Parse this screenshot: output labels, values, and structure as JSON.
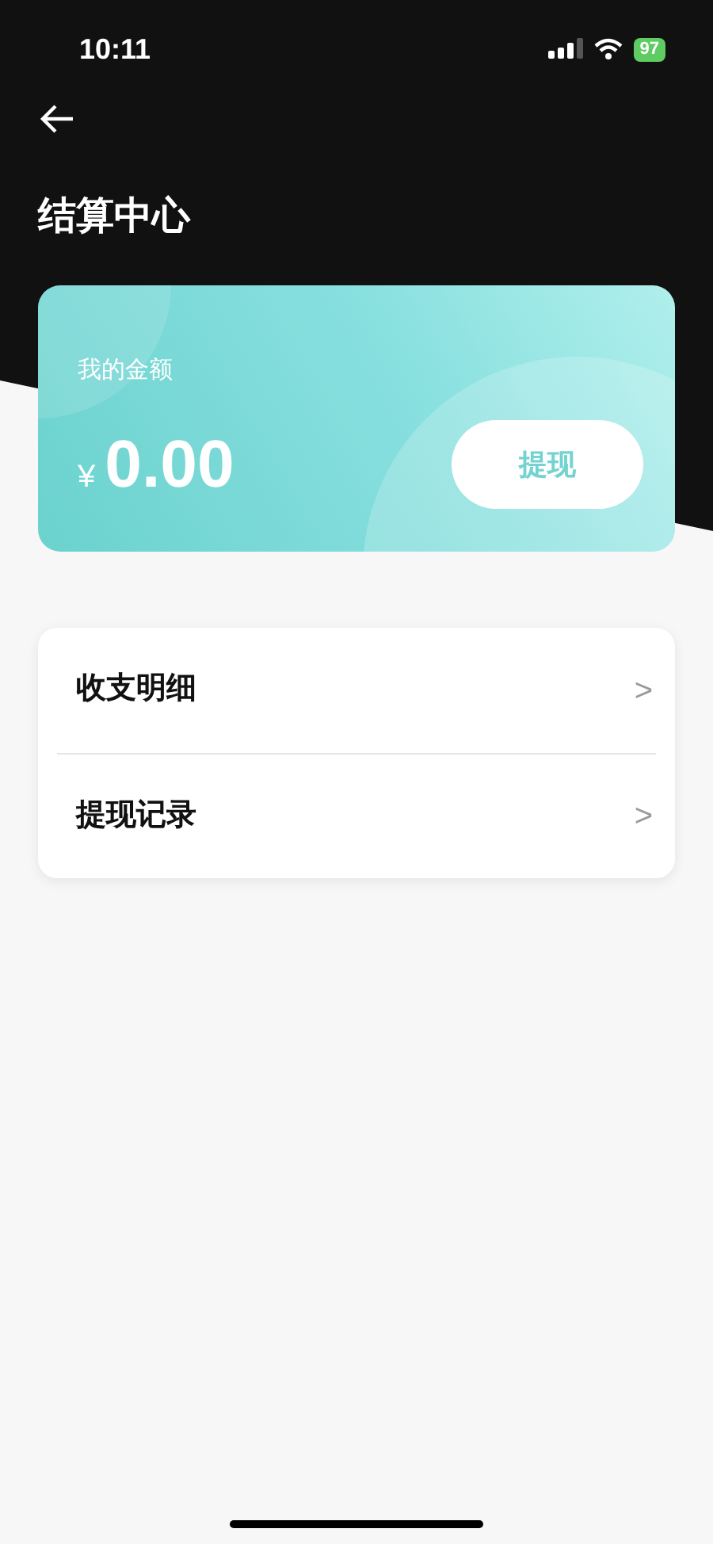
{
  "status_bar": {
    "time": "10:11",
    "battery": "97"
  },
  "header": {
    "title": "结算中心"
  },
  "balance_card": {
    "label": "我的金额",
    "currency": "¥",
    "amount": "0.00",
    "button": "提现"
  },
  "menu": [
    {
      "label": "收支明细",
      "chevron": ">"
    },
    {
      "label": "提现记录",
      "chevron": ">"
    }
  ]
}
